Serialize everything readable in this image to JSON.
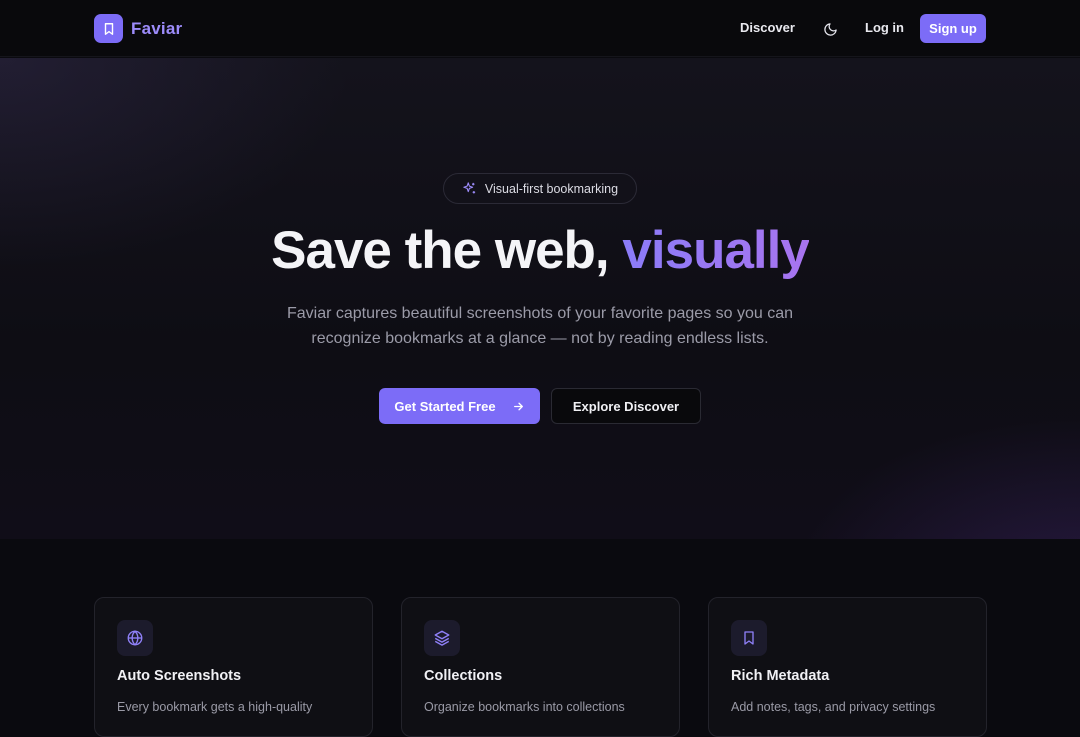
{
  "nav": {
    "brand": "Faviar",
    "discover": "Discover",
    "login": "Log in",
    "signup": "Sign up"
  },
  "hero": {
    "badge": "Visual-first bookmarking",
    "headline_plain": "Save the web, ",
    "headline_accent": "visually",
    "subtext": "Faviar captures beautiful screenshots of your favorite pages so you can recognize bookmarks at a glance — not by reading endless lists.",
    "cta_primary": "Get Started Free",
    "cta_secondary": "Explore Discover"
  },
  "features": [
    {
      "icon": "globe-icon",
      "title": "Auto Screenshots",
      "desc": "Every bookmark gets a high-quality"
    },
    {
      "icon": "layers-icon",
      "title": "Collections",
      "desc": "Organize bookmarks into collections"
    },
    {
      "icon": "bookmark-icon",
      "title": "Rich Metadata",
      "desc": "Add notes, tags, and privacy settings"
    }
  ],
  "colors": {
    "accent": "#7c6cf7",
    "accent_text": "#9d8cfb",
    "background": "#0a0a0f"
  }
}
